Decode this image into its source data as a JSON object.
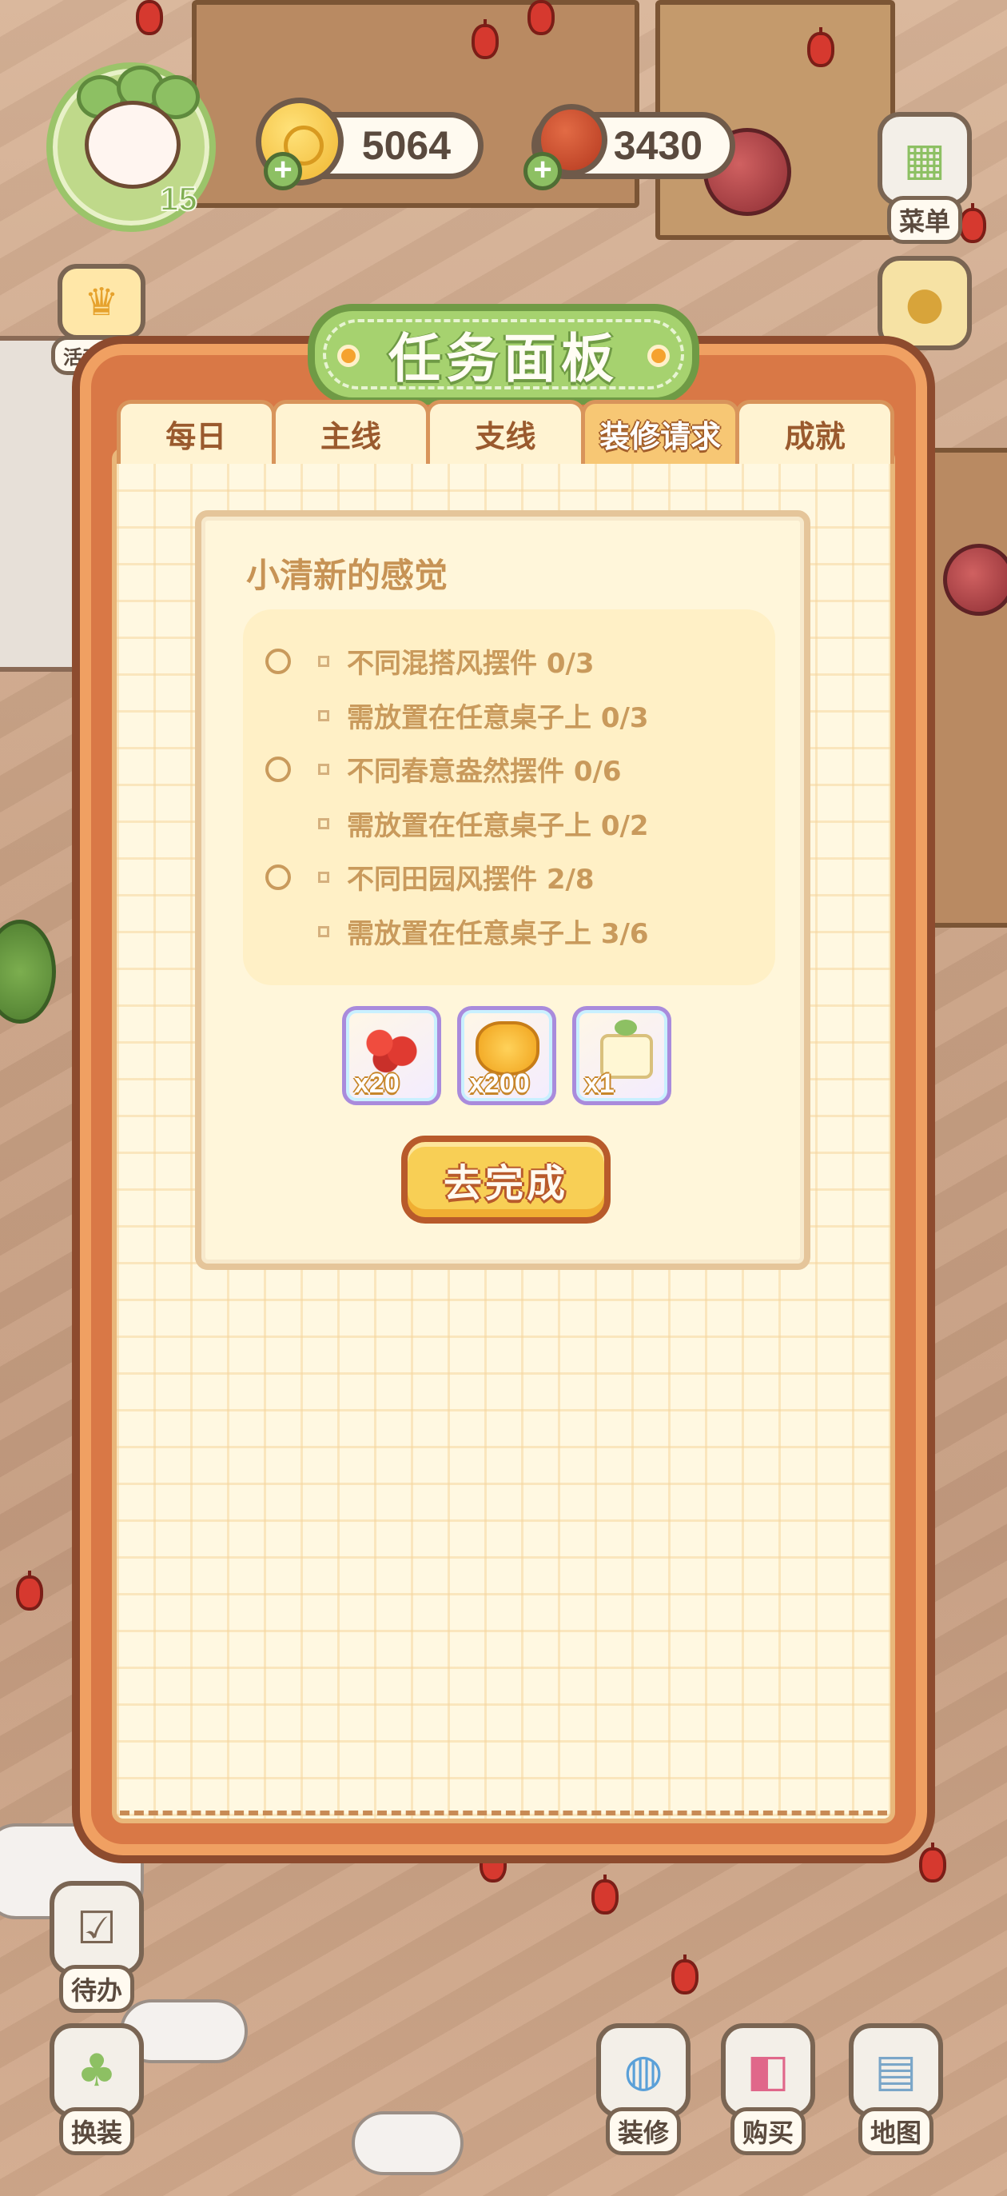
{
  "hud": {
    "level": "15",
    "coins": "5064",
    "meat": "3430",
    "plus": "+"
  },
  "side_buttons": {
    "menu": "菜单",
    "events": "活动汇总",
    "todo": "待办",
    "outfit": "换装",
    "decorate": "装修",
    "shop": "购买",
    "map": "地图"
  },
  "panel": {
    "title": "任务面板",
    "tabs": [
      {
        "label": "每日",
        "active": false
      },
      {
        "label": "主线",
        "active": false
      },
      {
        "label": "支线",
        "active": false
      },
      {
        "label": "装修请求",
        "active": true
      },
      {
        "label": "成就",
        "active": false
      }
    ]
  },
  "task": {
    "title": "小清新的感觉",
    "requirements": [
      {
        "text": "不同混搭风摆件 0/3",
        "sub": "需放置在任意桌子上 0/3"
      },
      {
        "text": "不同春意盎然摆件 0/6",
        "sub": "需放置在任意桌子上 0/2"
      },
      {
        "text": "不同田园风摆件 2/8",
        "sub": "需放置在任意桌子上 3/6"
      }
    ],
    "rewards": [
      {
        "item": "cherries",
        "qty": "x20"
      },
      {
        "item": "gold-nuggets",
        "qty": "x200"
      },
      {
        "item": "sprout-block",
        "qty": "x1"
      }
    ],
    "action_label": "去完成"
  }
}
